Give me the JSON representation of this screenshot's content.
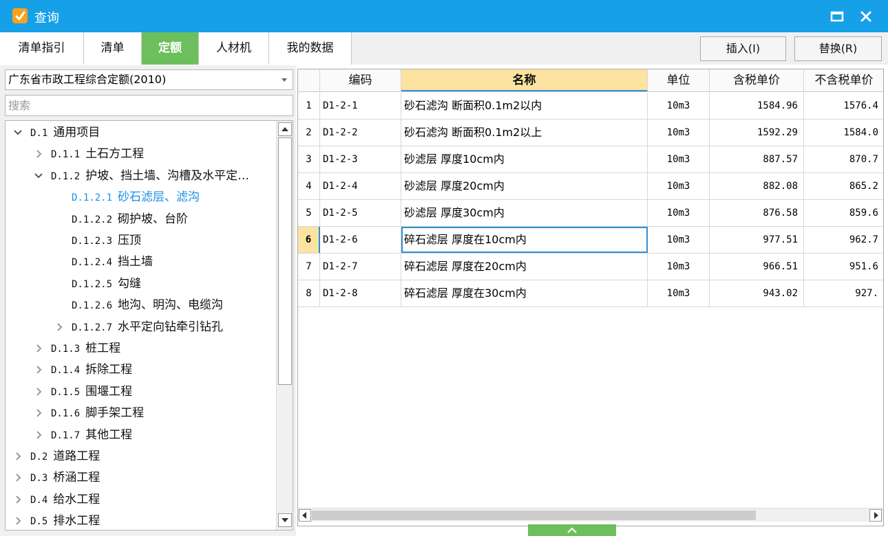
{
  "window": {
    "title": "查询"
  },
  "tabs": [
    {
      "label": "清单指引",
      "active": false
    },
    {
      "label": "清单",
      "active": false
    },
    {
      "label": "定额",
      "active": true
    },
    {
      "label": "人材机",
      "active": false
    },
    {
      "label": "我的数据",
      "active": false
    }
  ],
  "toolbar": {
    "insert_label": "插入(I)",
    "replace_label": "替换(R)"
  },
  "library": {
    "selected": "广东省市政工程综合定额(2010)"
  },
  "search": {
    "placeholder": "搜索",
    "value": ""
  },
  "tree": [
    {
      "code": "D.1",
      "label": "通用项目",
      "level": 0,
      "state": "expanded"
    },
    {
      "code": "D.1.1",
      "label": "土石方工程",
      "level": 1,
      "state": "collapsed"
    },
    {
      "code": "D.1.2",
      "label": "护坡、挡土墙、沟槽及水平定…",
      "level": 1,
      "state": "expanded"
    },
    {
      "code": "D.1.2.1",
      "label": "砂石滤层、滤沟",
      "level": 2,
      "state": "leaf",
      "selected": true
    },
    {
      "code": "D.1.2.2",
      "label": "砌护坡、台阶",
      "level": 2,
      "state": "leaf"
    },
    {
      "code": "D.1.2.3",
      "label": "压顶",
      "level": 2,
      "state": "leaf"
    },
    {
      "code": "D.1.2.4",
      "label": "挡土墙",
      "level": 2,
      "state": "leaf"
    },
    {
      "code": "D.1.2.5",
      "label": "勾缝",
      "level": 2,
      "state": "leaf"
    },
    {
      "code": "D.1.2.6",
      "label": "地沟、明沟、电缆沟",
      "level": 2,
      "state": "leaf"
    },
    {
      "code": "D.1.2.7",
      "label": "水平定向钻牵引钻孔",
      "level": 2,
      "state": "collapsed"
    },
    {
      "code": "D.1.3",
      "label": "桩工程",
      "level": 1,
      "state": "collapsed"
    },
    {
      "code": "D.1.4",
      "label": "拆除工程",
      "level": 1,
      "state": "collapsed"
    },
    {
      "code": "D.1.5",
      "label": "围堰工程",
      "level": 1,
      "state": "collapsed"
    },
    {
      "code": "D.1.6",
      "label": "脚手架工程",
      "level": 1,
      "state": "collapsed"
    },
    {
      "code": "D.1.7",
      "label": "其他工程",
      "level": 1,
      "state": "collapsed"
    },
    {
      "code": "D.2",
      "label": "道路工程",
      "level": 0,
      "state": "collapsed"
    },
    {
      "code": "D.3",
      "label": "桥涵工程",
      "level": 0,
      "state": "collapsed"
    },
    {
      "code": "D.4",
      "label": "给水工程",
      "level": 0,
      "state": "collapsed"
    },
    {
      "code": "D.5",
      "label": "排水工程",
      "level": 0,
      "state": "collapsed"
    }
  ],
  "grid": {
    "columns": [
      "",
      "编码",
      "名称",
      "单位",
      "含税单价",
      "不含税单价"
    ],
    "sorted_column": "名称",
    "current_row": 6,
    "rows": [
      {
        "no": "1",
        "code": "D1-2-1",
        "name": "砂石滤沟 断面积0.1m2以内",
        "unit": "10m3",
        "price_tax": "1584.96",
        "price_notax": "1576.4"
      },
      {
        "no": "2",
        "code": "D1-2-2",
        "name": "砂石滤沟 断面积0.1m2以上",
        "unit": "10m3",
        "price_tax": "1592.29",
        "price_notax": "1584.0"
      },
      {
        "no": "3",
        "code": "D1-2-3",
        "name": "砂滤层 厚度10cm内",
        "unit": "10m3",
        "price_tax": "887.57",
        "price_notax": "870.7"
      },
      {
        "no": "4",
        "code": "D1-2-4",
        "name": "砂滤层 厚度20cm内",
        "unit": "10m3",
        "price_tax": "882.08",
        "price_notax": "865.2"
      },
      {
        "no": "5",
        "code": "D1-2-5",
        "name": "砂滤层 厚度30cm内",
        "unit": "10m3",
        "price_tax": "876.58",
        "price_notax": "859.6"
      },
      {
        "no": "6",
        "code": "D1-2-6",
        "name": "碎石滤层 厚度在10cm内",
        "unit": "10m3",
        "price_tax": "977.51",
        "price_notax": "962.7"
      },
      {
        "no": "7",
        "code": "D1-2-7",
        "name": "碎石滤层 厚度在20cm内",
        "unit": "10m3",
        "price_tax": "966.51",
        "price_notax": "951.6"
      },
      {
        "no": "8",
        "code": "D1-2-8",
        "name": "碎石滤层 厚度在30cm内",
        "unit": "10m3",
        "price_tax": "943.02",
        "price_notax": "927."
      }
    ]
  },
  "colors": {
    "titlebar": "#15a0e8",
    "active_tab": "#6dbf5e",
    "selected_text": "#1a8fe6",
    "header_highlight": "#fde3a1"
  }
}
